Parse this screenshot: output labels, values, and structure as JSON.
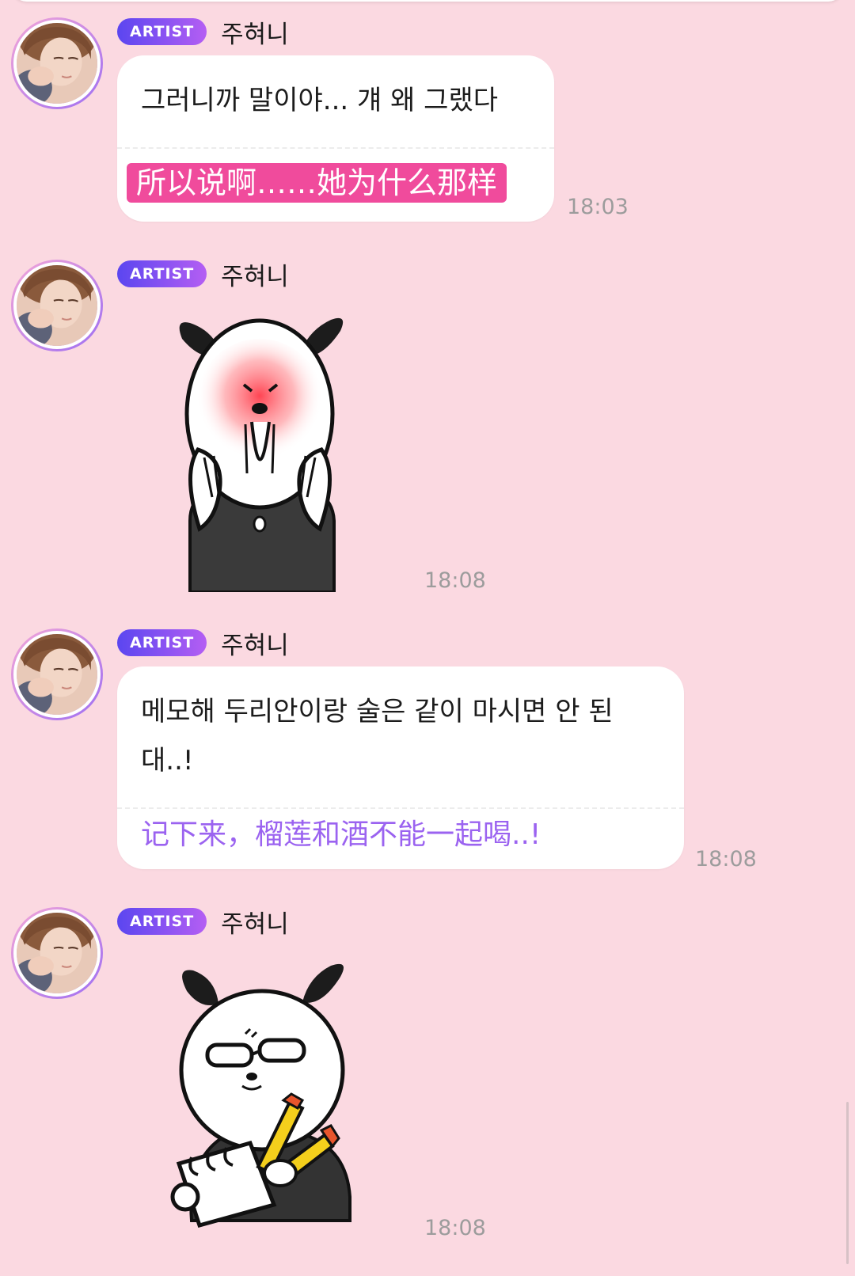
{
  "messages": [
    {
      "badge": "ARTIST",
      "sender": "주혀니",
      "original": "그러니까 말이야... 걔 왜 그랬다",
      "translation": "所以说啊……她为什么那样",
      "time": "18:03"
    },
    {
      "badge": "ARTIST",
      "sender": "주혀니",
      "sticker": "panda-screaming-sticker",
      "time": "18:08"
    },
    {
      "badge": "ARTIST",
      "sender": "주혀니",
      "original": "메모해 두리안이랑 술은 같이 마시면 안 된대..!",
      "translation": "记下来，榴莲和酒不能一起喝..!",
      "time": "18:08"
    },
    {
      "badge": "ARTIST",
      "sender": "주혀니",
      "sticker": "panda-taking-notes-sticker",
      "time": "18:08"
    }
  ],
  "colors": {
    "background": "#fbd9e1",
    "badge_start": "#5b46f0",
    "badge_end": "#b45ef3",
    "translation_highlight": "#f04b9c",
    "translation_purple": "#9b63f0",
    "timestamp": "#9c9c9c"
  }
}
